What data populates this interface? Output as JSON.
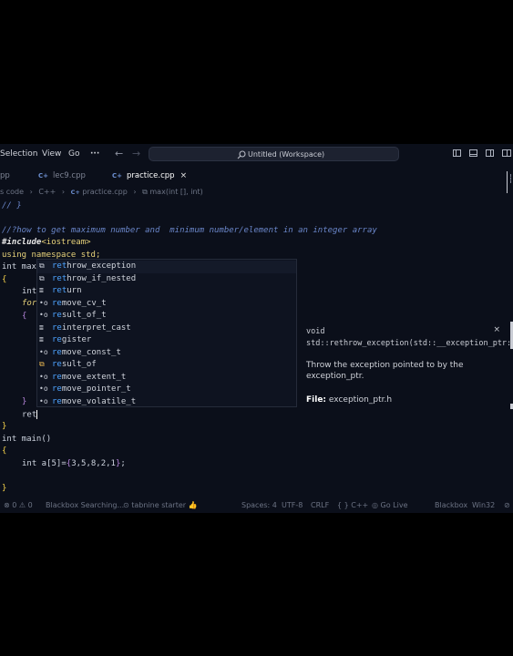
{
  "menu": {
    "selection": "Selection",
    "view": "View",
    "go": "Go",
    "more": "···"
  },
  "nav": {
    "back": "←",
    "forward": "→"
  },
  "search": {
    "icon": "search-icon",
    "text": "Untitled (Workspace)"
  },
  "tabs": [
    {
      "icon": "",
      "label": "pp"
    },
    {
      "icon": "C+",
      "label": "lec9.cpp"
    },
    {
      "icon": "C+",
      "label": "practice.cpp",
      "close": "×"
    }
  ],
  "breadcrumb": {
    "a": "s code",
    "b": "C++",
    "c": "practice.cpp",
    "d": "max(int [], int)",
    "sep": "›",
    "cp": "C+",
    "fn_icon": "⧉"
  },
  "code": {
    "l0": "// }",
    "l1": "//?how to get maximum number and  minimum number/element in an integer array",
    "l2_a": "#include",
    "l2_b": "<iostream>",
    "l3_a": "using",
    "l3_b": " namespace",
    "l3_c": " std;",
    "l4": "int max",
    "l5": "{",
    "l6": "int",
    "l7": "for",
    "l8": "{",
    "l9": "}",
    "l10": "ret",
    "l11": "}",
    "l12": "int main()",
    "l13": "{",
    "l14_a": "int a[5]=",
    "l14_b": "{",
    "l14_c": "3,5,8,2,1",
    "l14_d": "}",
    "l14_e": ";",
    "l15": "}"
  },
  "suggestions": [
    {
      "icon": "⧉",
      "match": "ret",
      "rest": "hrow_exception"
    },
    {
      "icon": "⧉",
      "match": "ret",
      "rest": "hrow_if_nested"
    },
    {
      "icon": "≣",
      "match": "ret",
      "rest": "urn"
    },
    {
      "icon": "•o",
      "match": "re",
      "rest": "move_cv_t"
    },
    {
      "icon": "•o",
      "match": "re",
      "rest": "sult_of_t"
    },
    {
      "icon": "≣",
      "match": "re",
      "rest": "interpret_cast"
    },
    {
      "icon": "≣",
      "match": "re",
      "rest": "gister"
    },
    {
      "icon": "•o",
      "match": "re",
      "rest": "move_const_t"
    },
    {
      "icon": "⧉",
      "match": "re",
      "rest": "sult_of"
    },
    {
      "icon": "•o",
      "match": "re",
      "rest": "move_extent_t"
    },
    {
      "icon": "•o",
      "match": "re",
      "rest": "move_pointer_t"
    },
    {
      "icon": "•o",
      "match": "re",
      "rest": "move_volatile_t"
    }
  ],
  "details": {
    "signature": "void std::rethrow_exception(std::__exception_ptr::exception_ptr)",
    "close": "×",
    "doc": "Throw the exception pointed to by the exception_ptr.",
    "file_label": "File:",
    "file_value": "exception_ptr.h"
  },
  "status": {
    "problems": "⊗ 0 ⚠ 0",
    "blackbox": "Blackbox Searching...",
    "tabnine": "⊙ tabnine starter 👍",
    "spaces": "Spaces: 4",
    "encoding": "UTF-8",
    "eol": "CRLF",
    "lang": "{ } C++",
    "golive": "◎ Go Live",
    "blackbox2": "Blackbox",
    "platform": "Win32",
    "bell": "⊘"
  }
}
